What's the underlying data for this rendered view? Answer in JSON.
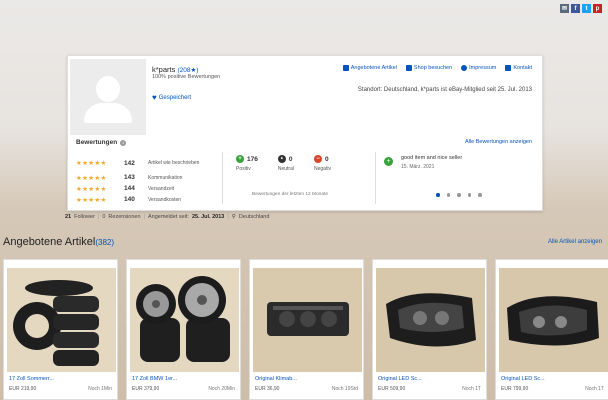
{
  "share_icons": [
    "mail-icon",
    "facebook-icon",
    "twitter-icon",
    "pinterest-icon"
  ],
  "seller": {
    "name": "k*parts",
    "score": "(208★)",
    "positive": "100% positive Bewertungen",
    "saved_label": "Gespeichert",
    "location": "Standort: Deutschland, k*parts ist eBay-Mitglied seit 25. Jul. 2013"
  },
  "toplinks": {
    "offered": "Angebotene Artikel",
    "shop": "Shop besuchen",
    "impressum": "Impressum",
    "contact": "Kontakt"
  },
  "reviews": {
    "heading": "Bewertungen",
    "all_label": "Alle Bewertungen anzeigen",
    "rows": [
      {
        "count": "142",
        "label": "Artikel wie beschrieben"
      },
      {
        "count": "143",
        "label": "Kommunikation"
      },
      {
        "count": "144",
        "label": "Versandzeit"
      },
      {
        "count": "140",
        "label": "Versandkosten"
      }
    ]
  },
  "feedback": {
    "positive_count": "176",
    "positive_label": "Positiv",
    "neutral_count": "0",
    "neutral_label": "Neutral",
    "negative_count": "0",
    "negative_label": "Negativ",
    "period": "Bewertungen der letzten 12 Monate"
  },
  "latest_review": {
    "text": "good item and nice seller",
    "date": "15. März. 2021"
  },
  "stats": {
    "followers_num": "21",
    "followers_label": "Follower",
    "reviews_num": "0",
    "reviews_label": "Rezensionen",
    "member_label": "Angemeldet seit:",
    "member_date": "25. Jul. 2013",
    "country": "Deutschland"
  },
  "section": {
    "title": "Angebotene Artikel",
    "count": "(382)",
    "all_label": "Alle Artikel anzeigen"
  },
  "items": [
    {
      "title": "17 Zoll Sommerr...",
      "price": "EUR 219,90",
      "time": "Noch 1Min"
    },
    {
      "title": "17 Zoll BMW 1er...",
      "price": "EUR 379,90",
      "time": "Noch 20Min"
    },
    {
      "title": "Original Klimab...",
      "price": "EUR 36,90",
      "time": "Noch 19Std"
    },
    {
      "title": "Original LED Sc...",
      "price": "EUR 509,90",
      "time": "Noch 1T"
    },
    {
      "title": "Original LED Sc...",
      "price": "EUR 799,90",
      "time": "Noch 1T"
    }
  ],
  "colors": {
    "link": "#0654ba",
    "star": "#f5a623",
    "positive": "#35a23a",
    "negative": "#d9452b"
  }
}
